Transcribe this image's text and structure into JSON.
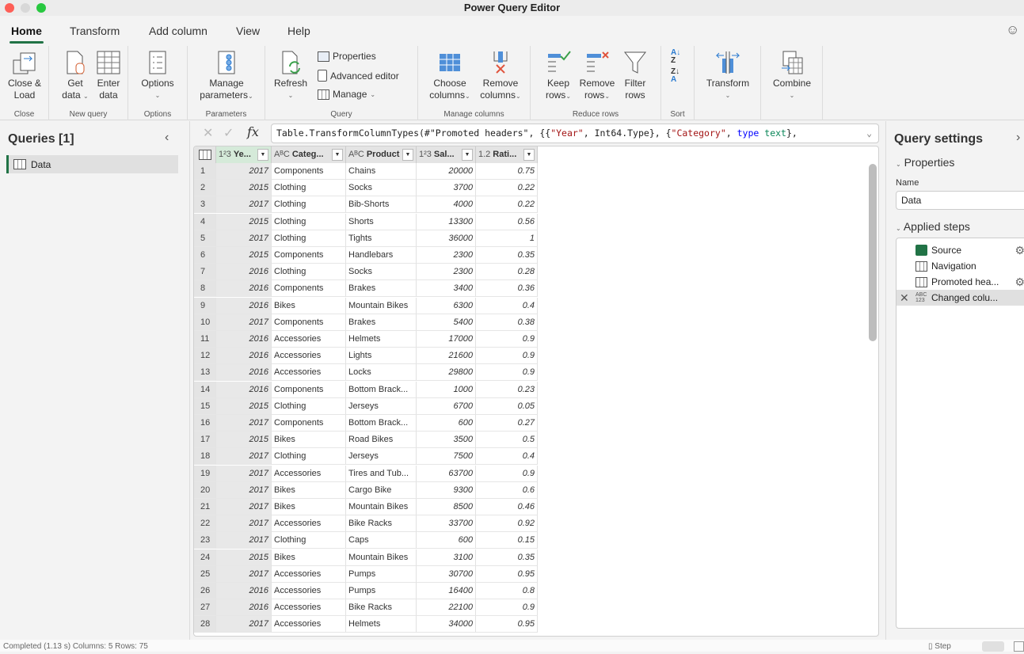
{
  "window": {
    "title": "Power Query Editor"
  },
  "tabs": [
    {
      "label": "Home",
      "active": true
    },
    {
      "label": "Transform"
    },
    {
      "label": "Add column"
    },
    {
      "label": "View"
    },
    {
      "label": "Help"
    }
  ],
  "ribbon": {
    "close": {
      "label": "Close",
      "close_load": "Close &",
      "close_load2": "Load"
    },
    "new_query": {
      "label": "New query",
      "get_data": "Get",
      "get_data2": "data",
      "enter_data": "Enter",
      "enter_data2": "data"
    },
    "options": {
      "label": "Options",
      "options": "Options"
    },
    "parameters": {
      "label": "Parameters",
      "manage": "Manage",
      "manage2": "parameters"
    },
    "query": {
      "label": "Query",
      "refresh": "Refresh",
      "properties": "Properties",
      "advanced_editor": "Advanced editor",
      "manage": "Manage"
    },
    "manage_columns": {
      "label": "Manage columns",
      "choose": "Choose",
      "choose2": "columns",
      "remove": "Remove",
      "remove2": "columns"
    },
    "reduce_rows": {
      "label": "Reduce rows",
      "keep": "Keep",
      "keep2": "rows",
      "remove": "Remove",
      "remove2": "rows",
      "filter": "Filter",
      "filter2": "rows"
    },
    "sort": {
      "label": "Sort"
    },
    "transform": {
      "label": "Transform"
    },
    "combine": {
      "label": "Combine"
    }
  },
  "queries": {
    "title": "Queries [1]",
    "items": [
      {
        "label": "Data"
      }
    ]
  },
  "formula": {
    "prefix": "Table.TransformColumnTypes(#\"Promoted headers\", {{",
    "s1": "\"Year\"",
    "mid": ", Int64.Type}, {",
    "s2": "\"Category\"",
    "sep": ", ",
    "kw": "type",
    "sp": " ",
    "tx": "text",
    "end": "},"
  },
  "columns": [
    {
      "type": "1²3",
      "name": "Ye..."
    },
    {
      "type": "AᴮC",
      "name": "Categ..."
    },
    {
      "type": "AᴮC",
      "name": "Product"
    },
    {
      "type": "1²3",
      "name": "Sal..."
    },
    {
      "type": "1.2",
      "name": "Rati..."
    }
  ],
  "rows": [
    [
      "2017",
      "Components",
      "Chains",
      "20000",
      "0.75"
    ],
    [
      "2015",
      "Clothing",
      "Socks",
      "3700",
      "0.22"
    ],
    [
      "2017",
      "Clothing",
      "Bib-Shorts",
      "4000",
      "0.22"
    ],
    [
      "2015",
      "Clothing",
      "Shorts",
      "13300",
      "0.56"
    ],
    [
      "2017",
      "Clothing",
      "Tights",
      "36000",
      "1"
    ],
    [
      "2015",
      "Components",
      "Handlebars",
      "2300",
      "0.35"
    ],
    [
      "2016",
      "Clothing",
      "Socks",
      "2300",
      "0.28"
    ],
    [
      "2016",
      "Components",
      "Brakes",
      "3400",
      "0.36"
    ],
    [
      "2016",
      "Bikes",
      "Mountain Bikes",
      "6300",
      "0.4"
    ],
    [
      "2017",
      "Components",
      "Brakes",
      "5400",
      "0.38"
    ],
    [
      "2016",
      "Accessories",
      "Helmets",
      "17000",
      "0.9"
    ],
    [
      "2016",
      "Accessories",
      "Lights",
      "21600",
      "0.9"
    ],
    [
      "2016",
      "Accessories",
      "Locks",
      "29800",
      "0.9"
    ],
    [
      "2016",
      "Components",
      "Bottom Brack...",
      "1000",
      "0.23"
    ],
    [
      "2015",
      "Clothing",
      "Jerseys",
      "6700",
      "0.05"
    ],
    [
      "2017",
      "Components",
      "Bottom Brack...",
      "600",
      "0.27"
    ],
    [
      "2015",
      "Bikes",
      "Road Bikes",
      "3500",
      "0.5"
    ],
    [
      "2017",
      "Clothing",
      "Jerseys",
      "7500",
      "0.4"
    ],
    [
      "2017",
      "Accessories",
      "Tires and Tub...",
      "63700",
      "0.9"
    ],
    [
      "2017",
      "Bikes",
      "Cargo Bike",
      "9300",
      "0.6"
    ],
    [
      "2017",
      "Bikes",
      "Mountain Bikes",
      "8500",
      "0.46"
    ],
    [
      "2017",
      "Accessories",
      "Bike Racks",
      "33700",
      "0.92"
    ],
    [
      "2017",
      "Clothing",
      "Caps",
      "600",
      "0.15"
    ],
    [
      "2015",
      "Bikes",
      "Mountain Bikes",
      "3100",
      "0.35"
    ],
    [
      "2017",
      "Accessories",
      "Pumps",
      "30700",
      "0.95"
    ],
    [
      "2016",
      "Accessories",
      "Pumps",
      "16400",
      "0.8"
    ],
    [
      "2016",
      "Accessories",
      "Bike Racks",
      "22100",
      "0.9"
    ],
    [
      "2017",
      "Accessories",
      "Helmets",
      "34000",
      "0.95"
    ]
  ],
  "settings": {
    "title": "Query settings",
    "properties": "Properties",
    "name_label": "Name",
    "name_value": "Data",
    "applied_steps": "Applied steps",
    "steps": [
      {
        "label": "Source",
        "gear": true
      },
      {
        "label": "Navigation"
      },
      {
        "label": "Promoted hea...",
        "gear": true
      },
      {
        "label": "Changed colu...",
        "selected": true
      }
    ]
  },
  "status": {
    "text": "Completed (1.13 s)    Columns: 5    Rows: 75",
    "step": "Step"
  },
  "colors": {
    "accent": "#217346",
    "string": "#a31515",
    "keyword": "#0000ff"
  }
}
